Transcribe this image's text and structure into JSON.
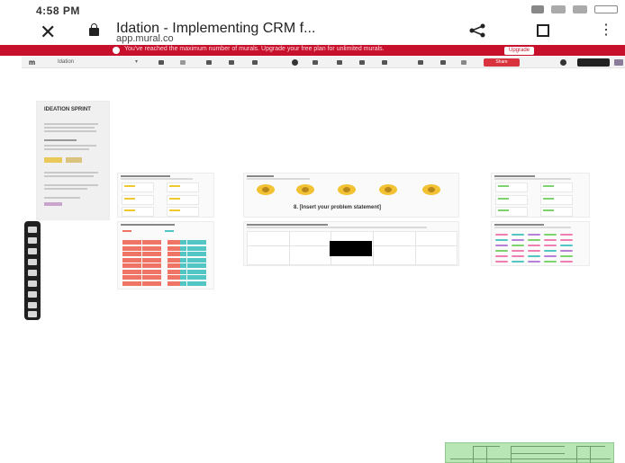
{
  "status_bar": {
    "time": "4:58 PM"
  },
  "browser": {
    "tab_title": "Idation - Implementing CRM f...",
    "url": "app.mural.co"
  },
  "banner": {
    "text": "You've reached the maximum number of murals. Upgrade your free plan for unlimited murals.",
    "button": "Upgrade"
  },
  "mural_toolbar": {
    "logo": "m",
    "board_name": "Idation",
    "share_label": "Share"
  },
  "board": {
    "intro_title": "IDEATION SPRINT",
    "problem_statement": "8. [Insert your problem statement]"
  },
  "colors": {
    "banner": "#c7102b",
    "sticky_yellow": "#f0c830",
    "sticky_green": "#7fd36d",
    "sticky_pink": "#ef7fb1",
    "grid_red": "#f07466",
    "grid_teal": "#52c6c4",
    "minimap": "#b8e6b5"
  }
}
